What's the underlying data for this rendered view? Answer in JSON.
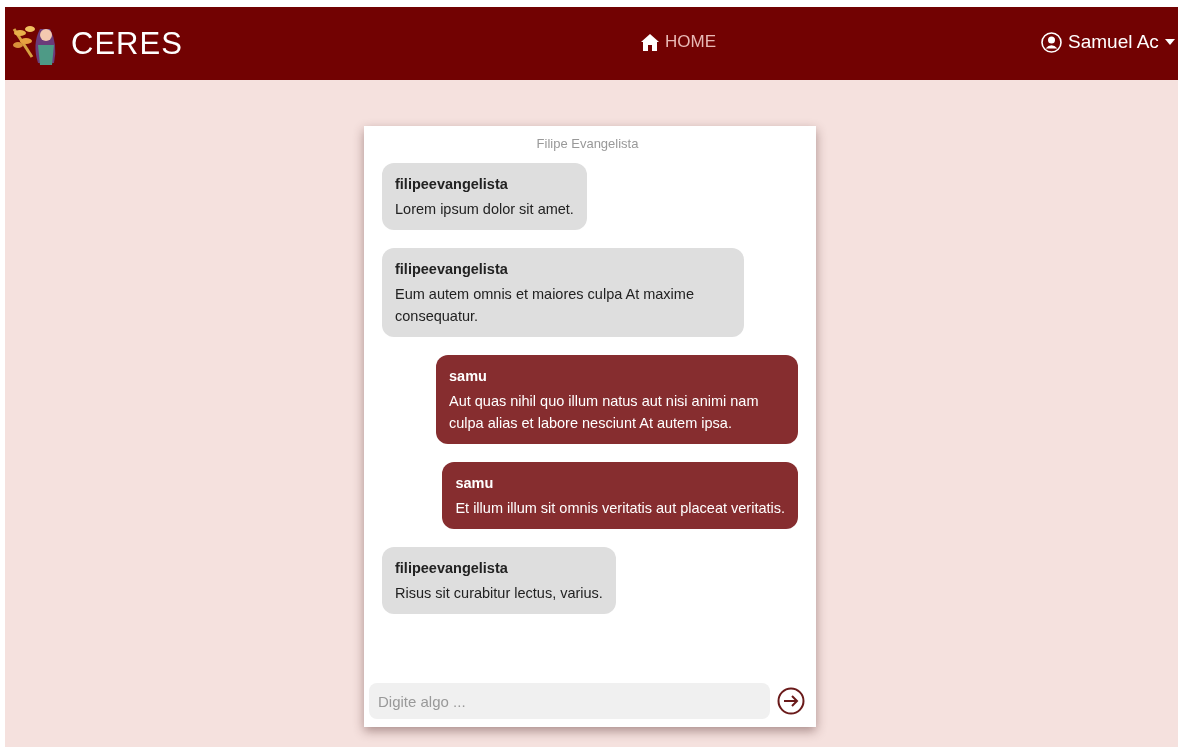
{
  "navbar": {
    "brand": "CERES",
    "home_link": "HOME",
    "user": "Samuel Ac"
  },
  "chat": {
    "title": "Filipe Evangelista",
    "messages": [
      {
        "kind": "received",
        "author": "filipeevangelista",
        "text": "Lorem ipsum dolor sit amet."
      },
      {
        "kind": "received",
        "author": "filipeevangelista",
        "text": "Eum autem omnis et maiores culpa At maxime consequatur."
      },
      {
        "kind": "sent",
        "author": "samu",
        "text": "Aut quas nihil quo illum natus aut nisi animi nam culpa alias et labore nesciunt At autem ipsa."
      },
      {
        "kind": "sent",
        "author": "samu",
        "text": "Et illum illum sit omnis veritatis aut placeat veritatis."
      },
      {
        "kind": "received",
        "author": "filipeevangelista",
        "text": "Risus sit curabitur lectus, varius."
      }
    ],
    "input": {
      "placeholder": "Digite algo ..."
    }
  }
}
